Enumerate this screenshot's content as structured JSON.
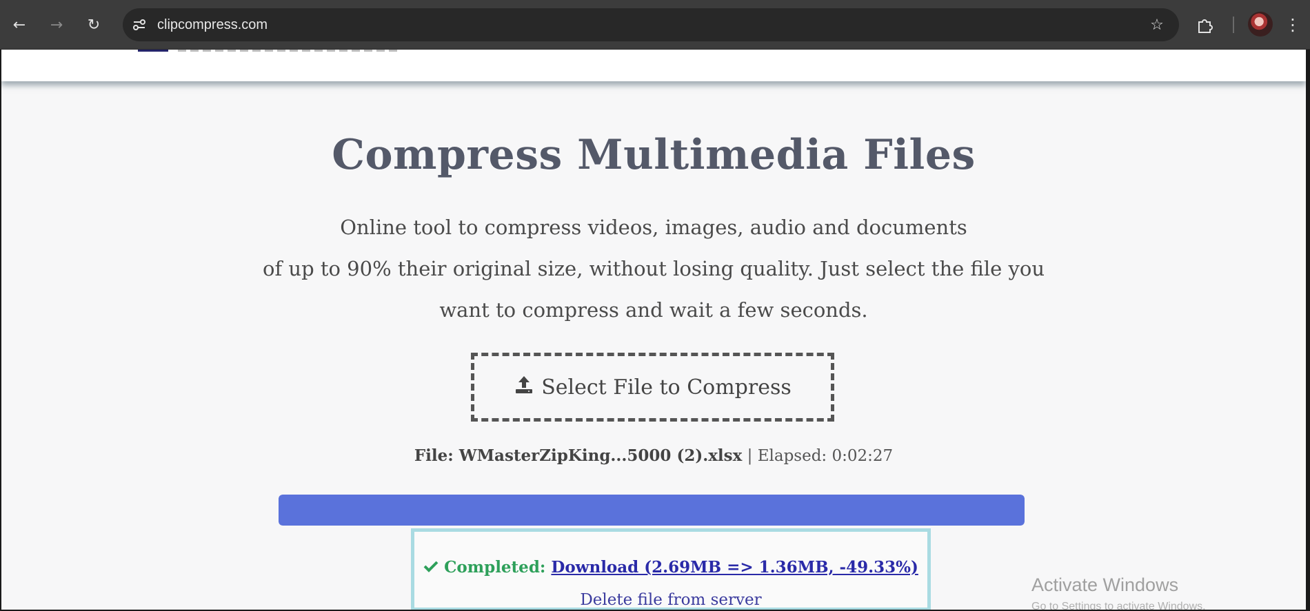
{
  "browser": {
    "url": "clipcompress.com",
    "back_icon": "←",
    "forward_icon": "→",
    "reload_icon": "↻",
    "star_icon": "☆",
    "menu_icon": "⋮"
  },
  "main": {
    "title": "Compress Multimedia Files",
    "subtitle_lines": [
      "Online tool to compress videos, images, audio and documents",
      "of up to 90% their original size, without losing quality. Just select the file you",
      "want to compress and wait a few seconds."
    ],
    "select_button_label": "Select File to Compress",
    "file_label": "File: WMasterZipKing...5000 (2).xlsx",
    "elapsed_label": "| Elapsed: 0:02:27",
    "progress_fraction": 1.0,
    "progress_color": "#5a72db",
    "completed_label": "Completed:",
    "download_label": "Download (2.69MB => 1.36MB, -49.33%)",
    "delete_label": "Delete file from server"
  },
  "overlay": {
    "activate_title": "Activate Windows",
    "activate_sub": "Go to Settings to activate Windows."
  }
}
